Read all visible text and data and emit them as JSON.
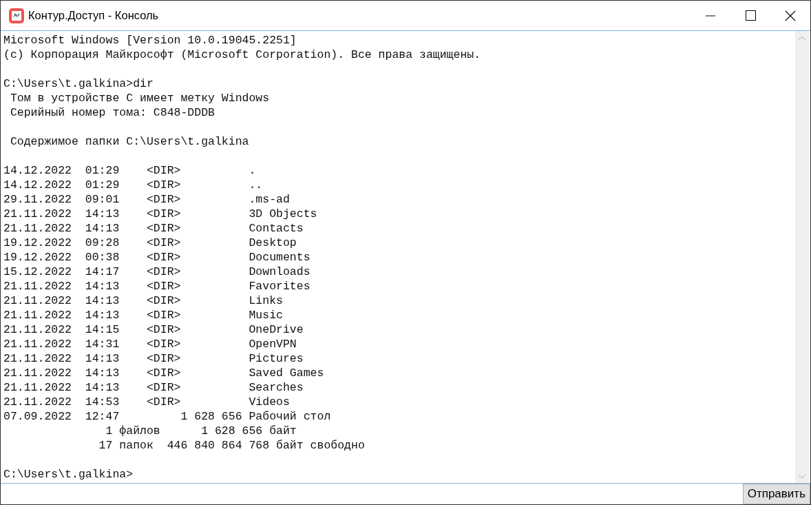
{
  "window": {
    "title": "Контур.Доступ - Консоль"
  },
  "console": {
    "blocks": [
      [
        "Microsoft Windows [Version 10.0.19045.2251]",
        "(c) Корпорация Майкрософт (Microsoft Corporation). Все права защищены."
      ],
      [
        "C:\\Users\\t.galkina>dir",
        " Том в устройстве C имеет метку Windows",
        " Серийный номер тома: C848-DDDB"
      ],
      [
        " Содержимое папки C:\\Users\\t.galkina"
      ],
      [
        "14.12.2022  01:29    <DIR>          .",
        "14.12.2022  01:29    <DIR>          ..",
        "29.11.2022  09:01    <DIR>          .ms-ad",
        "21.11.2022  14:13    <DIR>          3D Objects",
        "21.11.2022  14:13    <DIR>          Contacts",
        "19.12.2022  09:28    <DIR>          Desktop",
        "19.12.2022  00:38    <DIR>          Documents",
        "15.12.2022  14:17    <DIR>          Downloads",
        "21.11.2022  14:13    <DIR>          Favorites",
        "21.11.2022  14:13    <DIR>          Links",
        "21.11.2022  14:13    <DIR>          Music",
        "21.11.2022  14:15    <DIR>          OneDrive",
        "21.11.2022  14:31    <DIR>          OpenVPN",
        "21.11.2022  14:13    <DIR>          Pictures",
        "21.11.2022  14:13    <DIR>          Saved Games",
        "21.11.2022  14:13    <DIR>          Searches",
        "21.11.2022  14:53    <DIR>          Videos",
        "07.09.2022  12:47         1 628 656 Рабочий стол",
        "               1 файлов      1 628 656 байт",
        "              17 папок  446 840 864 768 байт свободно"
      ],
      [
        "C:\\Users\\t.galkina>"
      ]
    ]
  },
  "send_button": {
    "label": "Отправить"
  }
}
